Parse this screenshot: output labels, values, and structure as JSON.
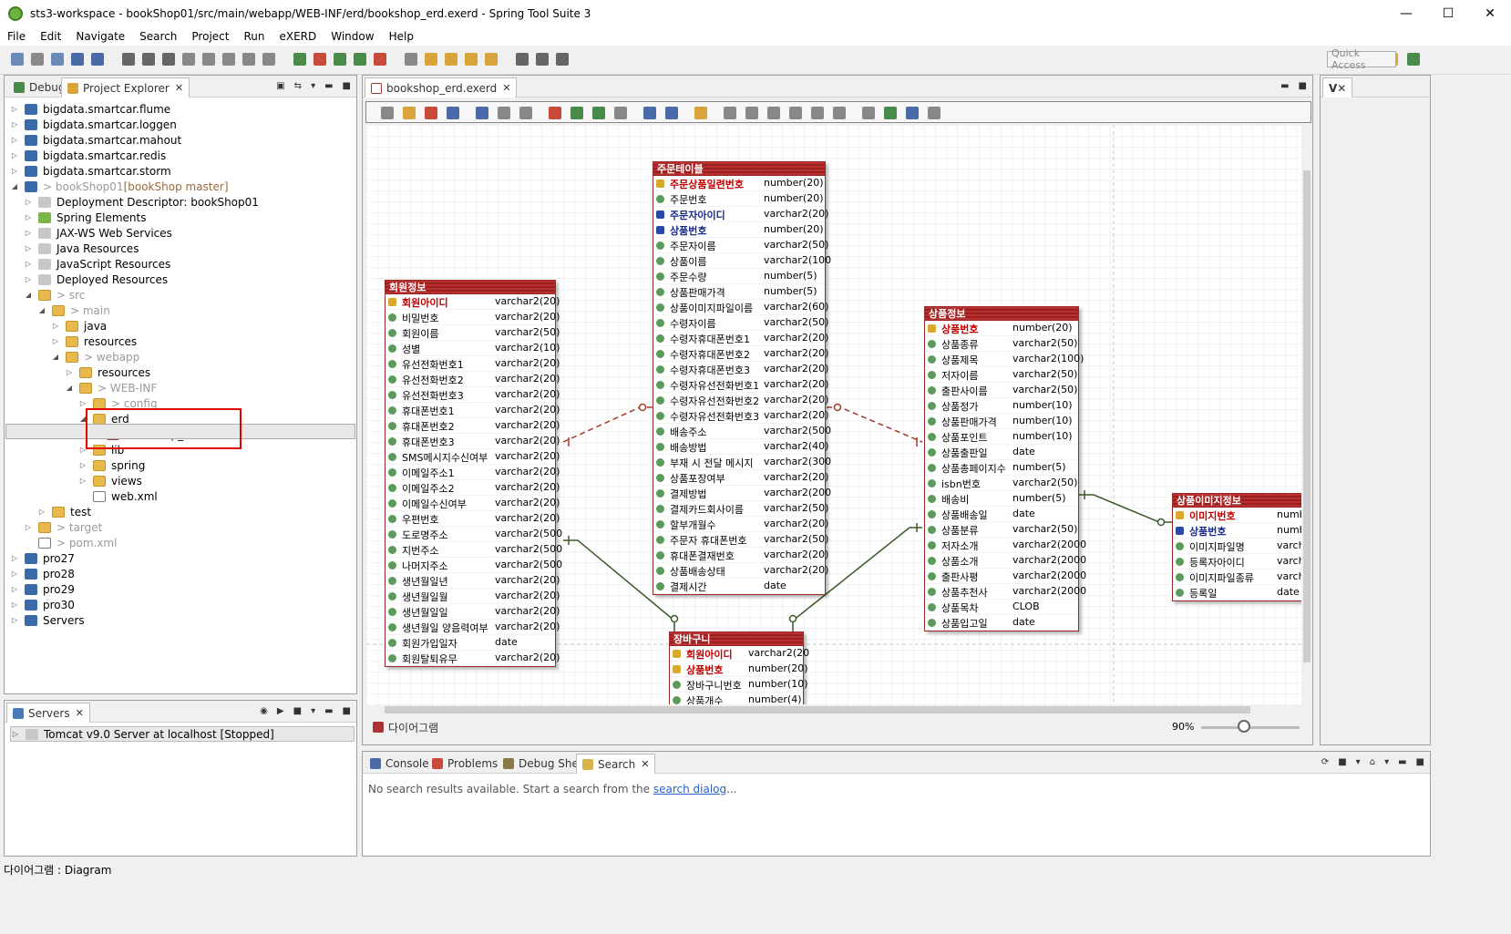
{
  "window": {
    "title": "sts3-workspace - bookShop01/src/main/webapp/WEB-INF/erd/bookshop_erd.exerd - Spring Tool Suite 3",
    "minimize": "—",
    "maximize": "☐",
    "close": "✕"
  },
  "menu": [
    "File",
    "Edit",
    "Navigate",
    "Search",
    "Project",
    "Run",
    "eXERD",
    "Window",
    "Help"
  ],
  "toolbar": {
    "quick_access_placeholder": "Quick Access"
  },
  "explorer": {
    "tabs": [
      {
        "label": "Debug"
      },
      {
        "label": "Project Explorer",
        "close": "✕"
      }
    ],
    "tree": [
      {
        "label": "bigdata.smartcar.flume",
        "arrow": "▷",
        "icon": "proj"
      },
      {
        "label": "bigdata.smartcar.loggen",
        "arrow": "▷",
        "icon": "proj"
      },
      {
        "label": "bigdata.smartcar.mahout",
        "arrow": "▷",
        "icon": "proj"
      },
      {
        "label": "bigdata.smartcar.redis",
        "arrow": "▷",
        "icon": "proj"
      },
      {
        "label": "bigdata.smartcar.storm",
        "arrow": "▷",
        "icon": "proj"
      },
      {
        "label": "> bookShop01",
        "extra": " [bookShop master]",
        "arrow": "◢",
        "icon": "proj",
        "muted": true
      },
      {
        "label": "Deployment Descriptor: bookShop01",
        "arrow": "▷",
        "icon": "gray"
      },
      {
        "label": "Spring Elements",
        "arrow": "▷",
        "icon": "green"
      },
      {
        "label": "JAX-WS Web Services",
        "arrow": "▷",
        "icon": "gray"
      },
      {
        "label": "Java Resources",
        "arrow": "▷",
        "icon": "gray"
      },
      {
        "label": "JavaScript Resources",
        "arrow": "▷",
        "icon": "gray"
      },
      {
        "label": "Deployed Resources",
        "arrow": "▷",
        "icon": "gray"
      },
      {
        "label": "> src",
        "arrow": "◢",
        "icon": "folder",
        "muted": true
      },
      {
        "label": "> main",
        "arrow": "◢",
        "icon": "folder",
        "muted": true
      },
      {
        "label": "java",
        "arrow": "▷",
        "icon": "folder"
      },
      {
        "label": "resources",
        "arrow": "▷",
        "icon": "folder"
      },
      {
        "label": "> webapp",
        "arrow": "◢",
        "icon": "folder",
        "muted": true
      },
      {
        "label": "resources",
        "arrow": "▷",
        "icon": "folder"
      },
      {
        "label": "> WEB-INF",
        "arrow": "◢",
        "icon": "folder",
        "muted": true
      },
      {
        "label": "> config",
        "arrow": "▷",
        "icon": "folder",
        "muted": true
      },
      {
        "label": "erd",
        "arrow": "◢",
        "icon": "folder"
      },
      {
        "label": "bookshop_erd.exerd",
        "arrow": "",
        "icon": "erd"
      },
      {
        "label": "lib",
        "arrow": "▷",
        "icon": "folder"
      },
      {
        "label": "spring",
        "arrow": "▷",
        "icon": "folder"
      },
      {
        "label": "views",
        "arrow": "▷",
        "icon": "folder"
      },
      {
        "label": "web.xml",
        "arrow": "",
        "icon": "file-xml"
      },
      {
        "label": "test",
        "arrow": "▷",
        "icon": "folder"
      },
      {
        "label": "> target",
        "arrow": "▷",
        "icon": "folder",
        "muted": true
      },
      {
        "label": "> pom.xml",
        "arrow": "",
        "icon": "file-xml",
        "muted": true
      },
      {
        "label": "pro27",
        "arrow": "▷",
        "icon": "proj"
      },
      {
        "label": "pro28",
        "arrow": "▷",
        "icon": "proj"
      },
      {
        "label": "pro29",
        "arrow": "▷",
        "icon": "proj"
      },
      {
        "label": "pro30",
        "arrow": "▷",
        "icon": "proj"
      },
      {
        "label": "Servers",
        "arrow": "▷",
        "icon": "proj"
      }
    ]
  },
  "servers": {
    "tab": "Servers",
    "close": "✕",
    "items": [
      {
        "label": "Tomcat v9.0 Server at localhost  [Stopped]"
      }
    ]
  },
  "editor": {
    "tab": "bookshop_erd.exerd",
    "close": "✕",
    "bottom_tab": "다이어그램",
    "zoom": "90%"
  },
  "erd": {
    "order": {
      "title": "주문테이블",
      "rows": [
        {
          "name": "주문상품일련번호",
          "type": "number(20)",
          "kind": "pk"
        },
        {
          "name": "주문번호",
          "type": "number(20)",
          "kind": ""
        },
        {
          "name": "주문자아이디",
          "type": "varchar2(20)",
          "kind": "fk"
        },
        {
          "name": "상품번호",
          "type": "number(20)",
          "kind": "fk"
        },
        {
          "name": "주문자이름",
          "type": "varchar2(50)",
          "kind": ""
        },
        {
          "name": "상품이름",
          "type": "varchar2(100",
          "kind": ""
        },
        {
          "name": "주문수량",
          "type": "number(5)",
          "kind": ""
        },
        {
          "name": "상품판매가격",
          "type": "number(5)",
          "kind": ""
        },
        {
          "name": "상품이미지파일이름",
          "type": "varchar2(60)",
          "kind": ""
        },
        {
          "name": "수령자이름",
          "type": "varchar2(50)",
          "kind": ""
        },
        {
          "name": "수령자휴대폰번호1",
          "type": "varchar2(20)",
          "kind": ""
        },
        {
          "name": "수령자휴대폰번호2",
          "type": "varchar2(20)",
          "kind": ""
        },
        {
          "name": "수령자휴대폰번호3",
          "type": "varchar2(20)",
          "kind": ""
        },
        {
          "name": "수령자유선전화번호1",
          "type": "varchar2(20)",
          "kind": ""
        },
        {
          "name": "수령자유선전화번호2",
          "type": "varchar2(20)",
          "kind": ""
        },
        {
          "name": "수령자유선전화번호3",
          "type": "varchar2(20)",
          "kind": ""
        },
        {
          "name": "배송주소",
          "type": "varchar2(500",
          "kind": ""
        },
        {
          "name": "배송방법",
          "type": "varchar2(40)",
          "kind": ""
        },
        {
          "name": "부재 시 전달 메시지",
          "type": "varchar2(300",
          "kind": ""
        },
        {
          "name": "상품포장여부",
          "type": "varchar2(20)",
          "kind": ""
        },
        {
          "name": "결제방법",
          "type": "varchar2(200",
          "kind": ""
        },
        {
          "name": "결제카드회사이름",
          "type": "varchar2(50)",
          "kind": ""
        },
        {
          "name": "할부개월수",
          "type": "varchar2(20)",
          "kind": ""
        },
        {
          "name": "주문자 휴대폰번호",
          "type": "varchar2(50)",
          "kind": ""
        },
        {
          "name": "휴대폰결재번호",
          "type": "varchar2(20)",
          "kind": ""
        },
        {
          "name": "상품배송상태",
          "type": "varchar2(20)",
          "kind": ""
        },
        {
          "name": "결제시간",
          "type": "date",
          "kind": ""
        }
      ]
    },
    "member": {
      "title": "회원정보",
      "rows": [
        {
          "name": "회원아이디",
          "type": "varchar2(20)",
          "kind": "pk"
        },
        {
          "name": "비밀번호",
          "type": "varchar2(20)",
          "kind": ""
        },
        {
          "name": "회원이름",
          "type": "varchar2(50)",
          "kind": ""
        },
        {
          "name": "성별",
          "type": "varchar2(10)",
          "kind": ""
        },
        {
          "name": "유선전화번호1",
          "type": "varchar2(20)",
          "kind": ""
        },
        {
          "name": "유선전화번호2",
          "type": "varchar2(20)",
          "kind": ""
        },
        {
          "name": "유선전화번호3",
          "type": "varchar2(20)",
          "kind": ""
        },
        {
          "name": "휴대폰번호1",
          "type": "varchar2(20)",
          "kind": ""
        },
        {
          "name": "휴대폰번호2",
          "type": "varchar2(20)",
          "kind": ""
        },
        {
          "name": "휴대폰번호3",
          "type": "varchar2(20)",
          "kind": ""
        },
        {
          "name": "SMS메시지수신여부",
          "type": "varchar2(20)",
          "kind": ""
        },
        {
          "name": "이메일주소1",
          "type": "varchar2(20)",
          "kind": ""
        },
        {
          "name": "이메일주소2",
          "type": "varchar2(20)",
          "kind": ""
        },
        {
          "name": "이메일수신여부",
          "type": "varchar2(20)",
          "kind": ""
        },
        {
          "name": "우편번호",
          "type": "varchar2(20)",
          "kind": ""
        },
        {
          "name": "도로명주소",
          "type": "varchar2(500",
          "kind": ""
        },
        {
          "name": "지번주소",
          "type": "varchar2(500",
          "kind": ""
        },
        {
          "name": "나머지주소",
          "type": "varchar2(500",
          "kind": ""
        },
        {
          "name": "생년월일년",
          "type": "varchar2(20)",
          "kind": ""
        },
        {
          "name": "생년월일월",
          "type": "varchar2(20)",
          "kind": ""
        },
        {
          "name": "생년월일일",
          "type": "varchar2(20)",
          "kind": ""
        },
        {
          "name": "생년월일 양음력여부",
          "type": "varchar2(20)",
          "kind": ""
        },
        {
          "name": "회원가입일자",
          "type": "date",
          "kind": ""
        },
        {
          "name": "회원탈퇴유무",
          "type": "varchar2(20)",
          "kind": ""
        }
      ]
    },
    "cart": {
      "title": "장바구니",
      "rows": [
        {
          "name": "회원아이디",
          "type": "varchar2(20",
          "kind": "pk"
        },
        {
          "name": "상품번호",
          "type": "number(20)",
          "kind": "pk"
        },
        {
          "name": "장바구니번호",
          "type": "number(10)",
          "kind": ""
        },
        {
          "name": "상품개수",
          "type": "number(4)",
          "kind": ""
        }
      ]
    },
    "goods": {
      "title": "상품정보",
      "rows": [
        {
          "name": "상품번호",
          "type": "number(20)",
          "kind": "pk"
        },
        {
          "name": "상품종류",
          "type": "varchar2(50)",
          "kind": ""
        },
        {
          "name": "상품제목",
          "type": "varchar2(100)",
          "kind": ""
        },
        {
          "name": "저자이름",
          "type": "varchar2(50)",
          "kind": ""
        },
        {
          "name": "출판사이름",
          "type": "varchar2(50)",
          "kind": ""
        },
        {
          "name": "상품정가",
          "type": "number(10)",
          "kind": ""
        },
        {
          "name": "상품판매가격",
          "type": "number(10)",
          "kind": ""
        },
        {
          "name": "상품포인트",
          "type": "number(10)",
          "kind": ""
        },
        {
          "name": "상품출판일",
          "type": "date",
          "kind": ""
        },
        {
          "name": "상품총페이지수",
          "type": "number(5)",
          "kind": ""
        },
        {
          "name": "isbn번호",
          "type": "varchar2(50)",
          "kind": ""
        },
        {
          "name": "배송비",
          "type": "number(5)",
          "kind": ""
        },
        {
          "name": "상품배송일",
          "type": "date",
          "kind": ""
        },
        {
          "name": "상품분류",
          "type": "varchar2(50)",
          "kind": ""
        },
        {
          "name": "저자소개",
          "type": "varchar2(2000",
          "kind": ""
        },
        {
          "name": "상품소개",
          "type": "varchar2(2000",
          "kind": ""
        },
        {
          "name": "출판사평",
          "type": "varchar2(2000",
          "kind": ""
        },
        {
          "name": "상품추천사",
          "type": "varchar2(2000",
          "kind": ""
        },
        {
          "name": "상품목차",
          "type": "CLOB",
          "kind": ""
        },
        {
          "name": "상품입고일",
          "type": "date",
          "kind": ""
        }
      ]
    },
    "image": {
      "title": "상품이미지정보",
      "rows": [
        {
          "name": "이미지번호",
          "type": "number",
          "kind": "pk"
        },
        {
          "name": "상품번호",
          "type": "number",
          "kind": "fk"
        },
        {
          "name": "이미지파일명",
          "type": "varchar",
          "kind": ""
        },
        {
          "name": "등록자아이디",
          "type": "varchar",
          "kind": ""
        },
        {
          "name": "이미지파일종류",
          "type": "varchar",
          "kind": ""
        },
        {
          "name": "등록일",
          "type": "date",
          "kind": ""
        }
      ]
    }
  },
  "bottom_panel": {
    "tabs": [
      {
        "label": "Console"
      },
      {
        "label": "Problems"
      },
      {
        "label": "Debug Shell"
      },
      {
        "label": "Search",
        "close": "✕"
      }
    ],
    "message_prefix": "No search results available. Start a search from the ",
    "message_link": "search dialog",
    "message_suffix": "..."
  },
  "statusbar": {
    "text": "다이어그램 : Diagram"
  },
  "colors": {
    "erd_header": "#a82525",
    "selection_box": "#e00000",
    "link": "#2a62c8"
  }
}
